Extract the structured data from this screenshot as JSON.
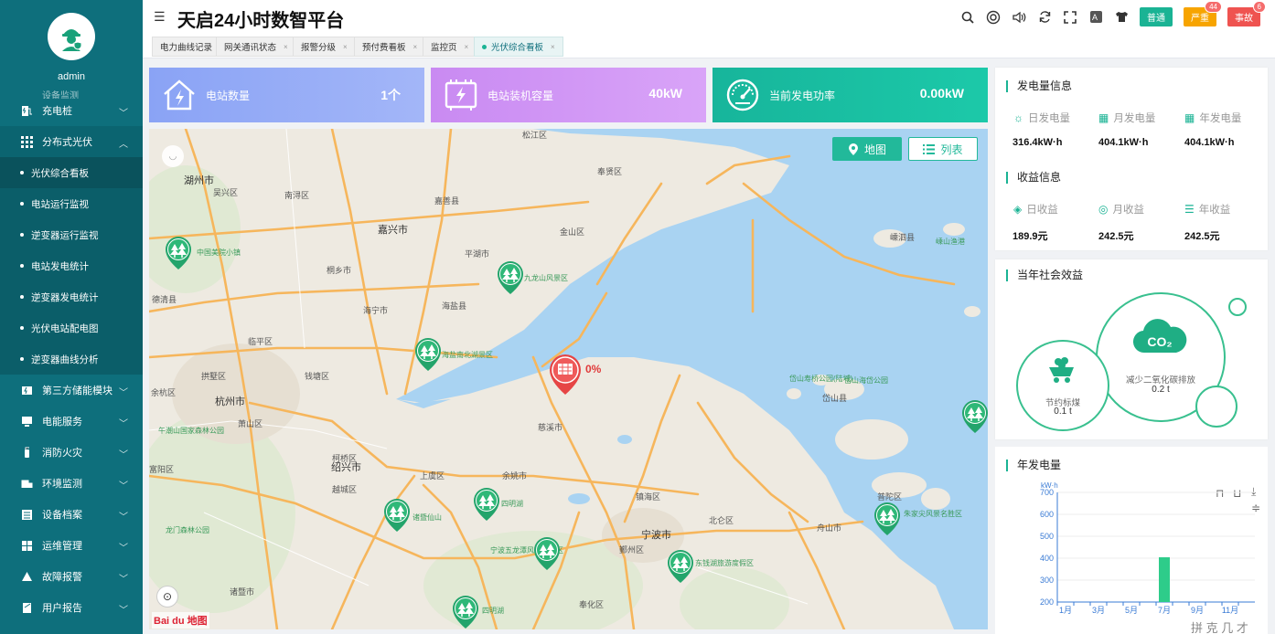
{
  "app": {
    "title": "天启24小时数智平台",
    "username": "admin"
  },
  "header": {
    "levels": [
      {
        "label": "普通",
        "color": "#1ab394",
        "badge": ""
      },
      {
        "label": "严重",
        "color": "#f7a400",
        "badge": "44"
      },
      {
        "label": "事故",
        "color": "#ef5350",
        "badge": "6"
      }
    ]
  },
  "tabs": [
    {
      "label": "电力曲线记录",
      "closable": false
    },
    {
      "label": "网关通讯状态",
      "closable": true
    },
    {
      "label": "报警分级",
      "closable": true
    },
    {
      "label": "预付费看板",
      "closable": true
    },
    {
      "label": "监控页",
      "closable": true
    },
    {
      "label": "光伏综合看板",
      "closable": true,
      "active": true
    }
  ],
  "sidebar": {
    "cut_item": "设备监测",
    "items": [
      {
        "label": "充电桩",
        "icon": "charging-pile-icon"
      },
      {
        "label": "分布式光伏",
        "icon": "grid-icon",
        "open": true
      }
    ],
    "sub_items": [
      {
        "label": "光伏综合看板",
        "active": true
      },
      {
        "label": "电站运行监视"
      },
      {
        "label": "逆变器运行监视"
      },
      {
        "label": "电站发电统计"
      },
      {
        "label": "逆变器发电统计"
      },
      {
        "label": "光伏电站配电图"
      },
      {
        "label": "逆变器曲线分析"
      }
    ],
    "more_items": [
      {
        "label": "第三方储能模块",
        "icon": "storage-icon"
      },
      {
        "label": "电能服务",
        "icon": "monitor-icon"
      },
      {
        "label": "消防火灾",
        "icon": "extinguisher-icon"
      },
      {
        "label": "环境监测",
        "icon": "environment-icon"
      },
      {
        "label": "设备档案",
        "icon": "archive-icon"
      },
      {
        "label": "运维管理",
        "icon": "maintenance-icon"
      },
      {
        "label": "故障报警",
        "icon": "alarm-icon"
      },
      {
        "label": "用户报告",
        "icon": "report-icon"
      }
    ]
  },
  "stats": [
    {
      "label": "电站数量",
      "value": "1个",
      "color_from": "#8aa3f5",
      "color_to": "#a3b6f8"
    },
    {
      "label": "电站装机容量",
      "value": "40kW",
      "color_from": "#c98af2",
      "color_to": "#d9a4f8"
    },
    {
      "label": "当前发电功率",
      "value": "0.00kW",
      "color_from": "#17b59b",
      "color_to": "#1cc9a9"
    }
  ],
  "map": {
    "btn_map": "地图",
    "btn_list": "列表",
    "alarm_percent": "0%",
    "logo": "Bai du 地图",
    "labels": [
      {
        "t": "湖州市"
      },
      {
        "t": "吴兴区"
      },
      {
        "t": "南浔区"
      },
      {
        "t": "嘉善县"
      },
      {
        "t": "嘉兴市"
      },
      {
        "t": "平湖市"
      },
      {
        "t": "奉贤区"
      },
      {
        "t": "金山区"
      },
      {
        "t": "松江区"
      },
      {
        "t": "桐乡市"
      },
      {
        "t": "德清县"
      },
      {
        "t": "海宁市"
      },
      {
        "t": "海盐县"
      },
      {
        "t": "临平区"
      },
      {
        "t": "拱墅区"
      },
      {
        "t": "余杭区"
      },
      {
        "t": "杭州市"
      },
      {
        "t": "萧山区"
      },
      {
        "t": "钱塘区"
      },
      {
        "t": "柯桥区"
      },
      {
        "t": "绍兴市"
      },
      {
        "t": "上虞区"
      },
      {
        "t": "余姚市"
      },
      {
        "t": "慈溪市"
      },
      {
        "t": "越城区"
      },
      {
        "t": "镇海区"
      },
      {
        "t": "宁波市"
      },
      {
        "t": "鄞州区"
      },
      {
        "t": "北仑区"
      },
      {
        "t": "舟山市"
      },
      {
        "t": "普陀区"
      },
      {
        "t": "岱山县"
      },
      {
        "t": "嵊泗县"
      },
      {
        "t": "诸暨市"
      },
      {
        "t": "奉化区"
      },
      {
        "t": "富阳区"
      },
      {
        "t": "中国美院小镇"
      },
      {
        "t": "九龙山风景区"
      },
      {
        "t": "海盐南北湖景区"
      },
      {
        "t": "东钱湖旅游度假区"
      },
      {
        "t": "四明湖"
      },
      {
        "t": "宁波五龙潭风景名胜区"
      },
      {
        "t": "朱家尖风景名胜区"
      },
      {
        "t": "岱山寿桥公园(陆域)"
      },
      {
        "t": "岱山海岱公园"
      },
      {
        "t": "嵊山渔港"
      },
      {
        "t": "午潮山国家森林公园"
      },
      {
        "t": "龙门森林公园"
      },
      {
        "t": "诸暨仙山"
      },
      {
        "t": "四明湖"
      }
    ]
  },
  "generation": {
    "title": "发电量信息",
    "items": [
      {
        "label": "日发电量",
        "value": "316.4kW·h",
        "icon": "sun-icon"
      },
      {
        "label": "月发电量",
        "value": "404.1kW·h",
        "icon": "calendar-icon"
      },
      {
        "label": "年发电量",
        "value": "404.1kW·h",
        "icon": "calendar-icon"
      }
    ]
  },
  "income": {
    "title": "收益信息",
    "items": [
      {
        "label": "日收益",
        "value": "189.9元",
        "icon": "coin-bag-icon"
      },
      {
        "label": "月收益",
        "value": "242.5元",
        "icon": "money-bag-icon"
      },
      {
        "label": "年收益",
        "value": "242.5元",
        "icon": "coin-stack-icon"
      }
    ]
  },
  "social": {
    "title": "当年社会效益",
    "coal_label": "节约标煤",
    "coal_value": "0.1 t",
    "co2_label": "减少二氧化碳排放",
    "co2_value": "0.2 t",
    "co2_icon_text": "CO₂"
  },
  "chart_data": {
    "type": "bar",
    "title": "年发电量",
    "ylabel": "kW·h",
    "ylim": [
      200,
      700
    ],
    "yticks": [
      200,
      300,
      400,
      500,
      600,
      700
    ],
    "xticks": [
      "1月",
      "3月",
      "5月",
      "7月",
      "9月",
      "11月"
    ],
    "categories": [
      "1月",
      "2月",
      "3月",
      "4月",
      "5月",
      "6月",
      "7月",
      "8月",
      "9月",
      "10月",
      "11月",
      "12月"
    ],
    "values": [
      0,
      0,
      0,
      0,
      0,
      0,
      404.1,
      0,
      0,
      0,
      0,
      0
    ],
    "color": "#2ecc8a"
  },
  "footer_hint": "拼 克 几 才"
}
